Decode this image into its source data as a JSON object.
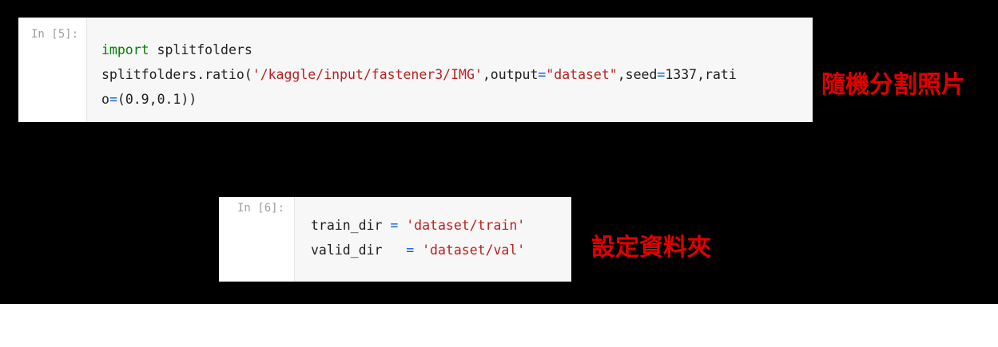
{
  "cell1": {
    "prompt": "In [5]:",
    "lines": [
      [
        [
          "kw",
          "import"
        ],
        [
          "txt",
          " splitfolders"
        ]
      ],
      [
        [
          "txt",
          "splitfolders.ratio("
        ],
        [
          "str",
          "'/kaggle/input/fastener3/IMG'"
        ],
        [
          "txt",
          ",output"
        ],
        [
          "op",
          "="
        ],
        [
          "str",
          "\"dataset\""
        ],
        [
          "txt",
          ",seed"
        ],
        [
          "op",
          "="
        ],
        [
          "num",
          "1337"
        ],
        [
          "txt",
          ",rati"
        ]
      ],
      [
        [
          "txt",
          "o"
        ],
        [
          "op",
          "="
        ],
        [
          "txt",
          "("
        ],
        [
          "num",
          "0.9"
        ],
        [
          "txt",
          ","
        ],
        [
          "num",
          "0.1"
        ],
        [
          "txt",
          "))"
        ]
      ]
    ]
  },
  "cell2": {
    "prompt": "In [6]:",
    "lines": [
      [
        [
          "txt",
          "train_dir "
        ],
        [
          "op",
          "="
        ],
        [
          "txt",
          " "
        ],
        [
          "str",
          "'dataset/train'"
        ]
      ],
      [
        [
          "txt",
          "valid_dir   "
        ],
        [
          "op",
          "="
        ],
        [
          "txt",
          " "
        ],
        [
          "str",
          "'dataset/val'"
        ]
      ]
    ]
  },
  "annotations": {
    "split_note": "隨機分割照片",
    "folder_note": "設定資料夾"
  },
  "colors": {
    "keyword": "#008000",
    "string": "#ba2121",
    "operator": "#055be0",
    "annotation": "#e00000"
  }
}
